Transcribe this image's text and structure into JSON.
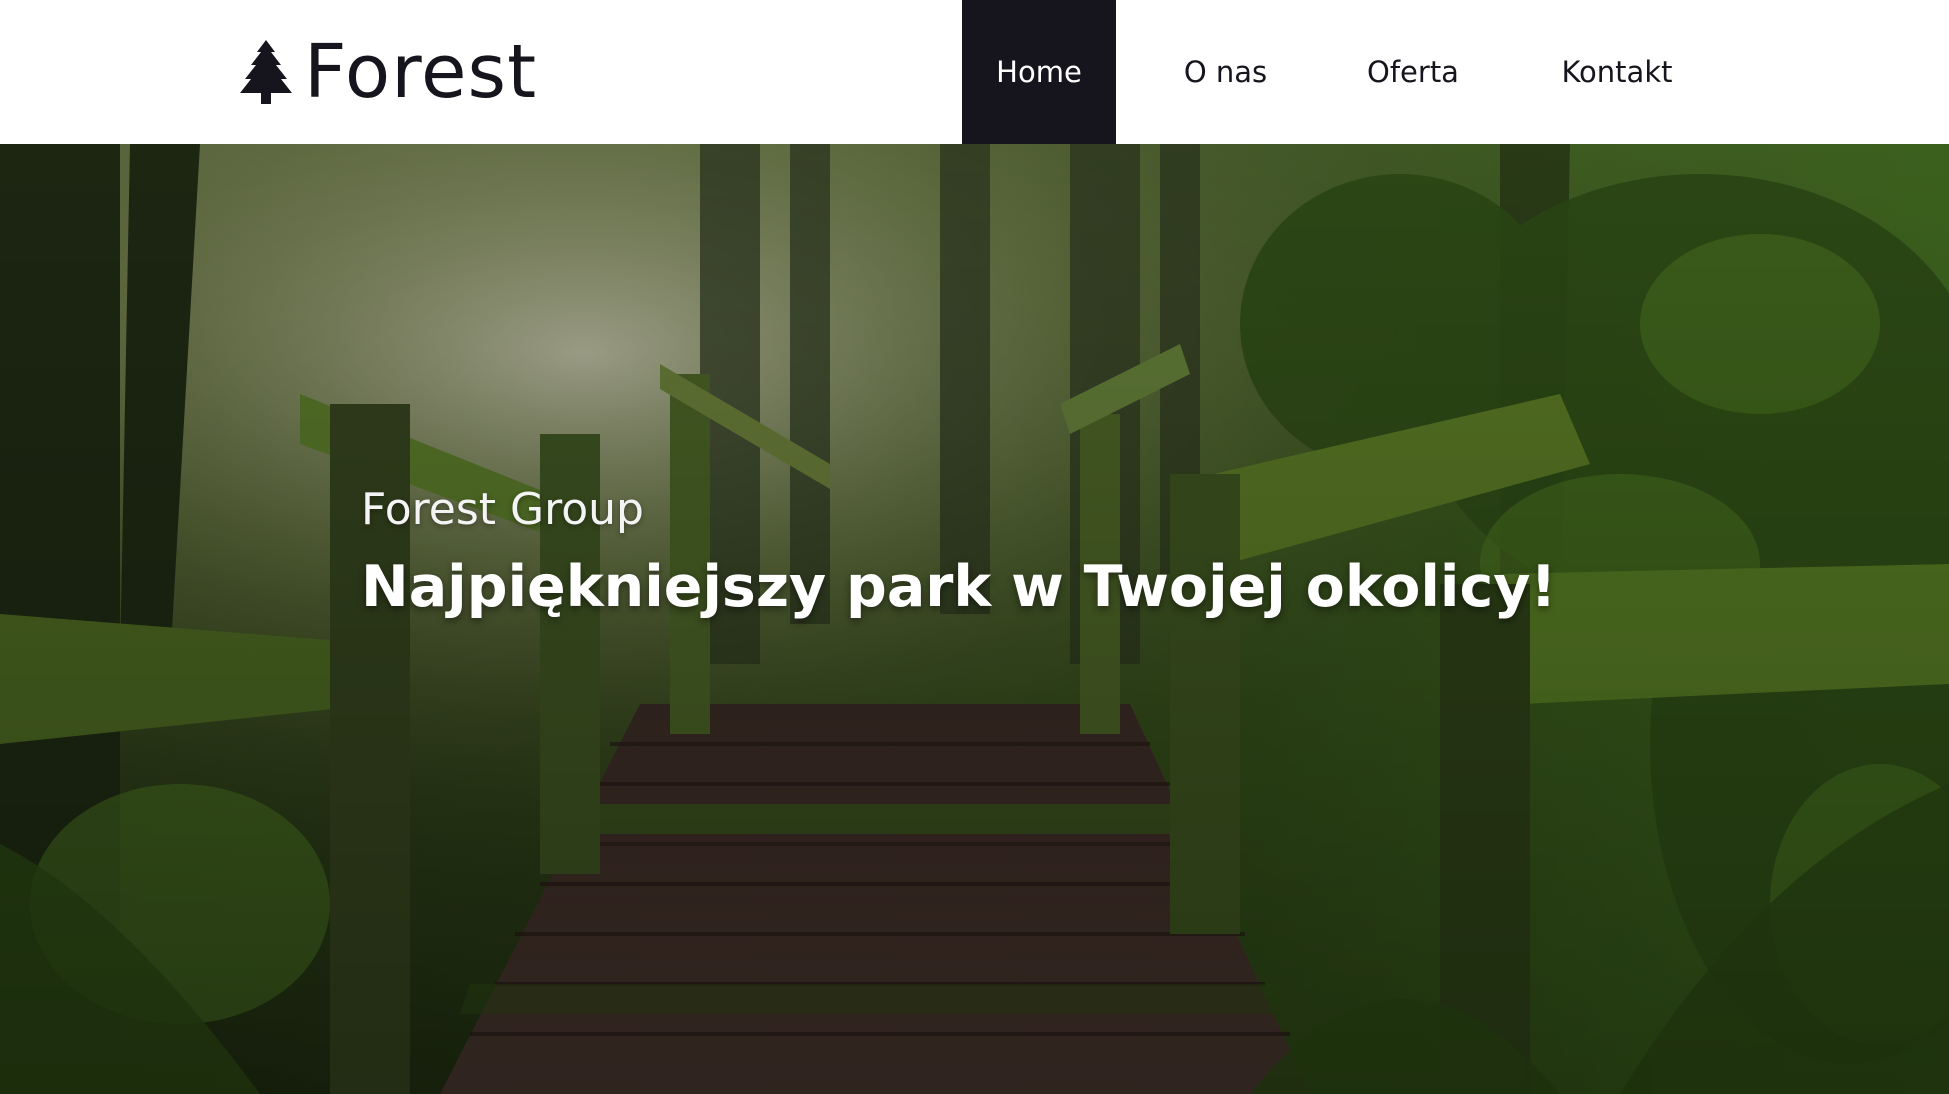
{
  "header": {
    "logo_text": "Forest",
    "logo_icon": "pine-tree-icon"
  },
  "nav": {
    "items": [
      {
        "label": "Home",
        "active": true
      },
      {
        "label": "O nas",
        "active": false
      },
      {
        "label": "Oferta",
        "active": false
      },
      {
        "label": "Kontakt",
        "active": false
      }
    ]
  },
  "hero": {
    "subtitle": "Forest Group",
    "title": "Najpiękniejszy park w Twojej okolicy!",
    "background": "forest-boardwalk-photo"
  },
  "colors": {
    "brand_dark": "#16151d",
    "text_light": "#ffffff",
    "forest_green": "#3f5a24",
    "moss": "#5e7a2c",
    "wood": "#4a3328"
  }
}
